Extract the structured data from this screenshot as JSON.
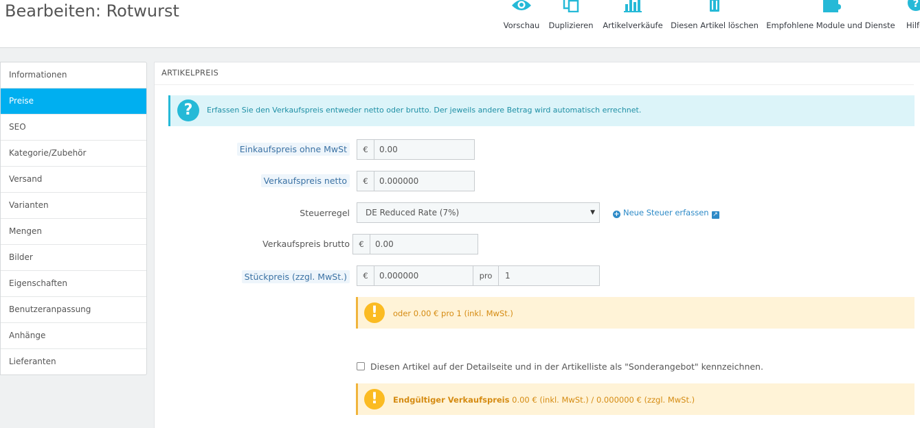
{
  "page": {
    "title": "Bearbeiten: Rotwurst"
  },
  "toolbar": {
    "items": [
      {
        "label": "Vorschau",
        "icon": "eye-icon"
      },
      {
        "label": "Duplizieren",
        "icon": "copy-icon"
      },
      {
        "label": "Artikelverkäufe",
        "icon": "bar-chart-icon"
      },
      {
        "label": "Diesen Artikel löschen",
        "icon": "trash-icon"
      },
      {
        "label": "Empfohlene Module und Dienste",
        "icon": "puzzle-icon"
      },
      {
        "label": "Hilfe",
        "icon": "help-icon"
      }
    ]
  },
  "sidebar": {
    "items": [
      {
        "label": "Informationen"
      },
      {
        "label": "Preise"
      },
      {
        "label": "SEO"
      },
      {
        "label": "Kategorie/Zubehör"
      },
      {
        "label": "Versand"
      },
      {
        "label": "Varianten"
      },
      {
        "label": "Mengen"
      },
      {
        "label": "Bilder"
      },
      {
        "label": "Eigenschaften"
      },
      {
        "label": "Benutzeranpassung"
      },
      {
        "label": "Anhänge"
      },
      {
        "label": "Lieferanten"
      }
    ],
    "active": "Preise"
  },
  "panel": {
    "heading": "ARTIKELPREIS",
    "info_alert": "Erfassen Sie den Verkaufspreis entweder netto oder brutto. Der jeweils andere Betrag wird automatisch errechnet.",
    "fields": {
      "wholesale": {
        "label": "Einkaufspreis ohne MwSt",
        "currency": "€",
        "value": "0.00"
      },
      "net": {
        "label": "Verkaufspreis netto",
        "currency": "€",
        "value": "0.000000"
      },
      "tax": {
        "label": "Steuerregel",
        "selected": "DE Reduced Rate (7%)",
        "new_link": "Neue Steuer erfassen"
      },
      "gross": {
        "label": "Verkaufspreis brutto",
        "currency": "€",
        "value": "0.00"
      },
      "unit": {
        "label": "Stückpreis (zzgl. MwSt.)",
        "currency": "€",
        "value": "0.000000",
        "per_label": "pro",
        "per_value": "1"
      }
    },
    "unit_alert": "oder 0.00 € pro 1 (inkl. MwSt.)",
    "special_offer_label": "Diesen Artikel auf der Detailseite und in der Artikelliste als \"Sonderangebot\" kennzeichnen.",
    "final_alert": {
      "bold": "Endgültiger Verkaufspreis",
      "rest": " 0.00 € (inkl. MwSt.) / 0.000000 € (zzgl. MwSt.)"
    }
  },
  "colors": {
    "accent": "#00aff0",
    "info": "#25b9d7",
    "warning": "#fbbb22"
  }
}
